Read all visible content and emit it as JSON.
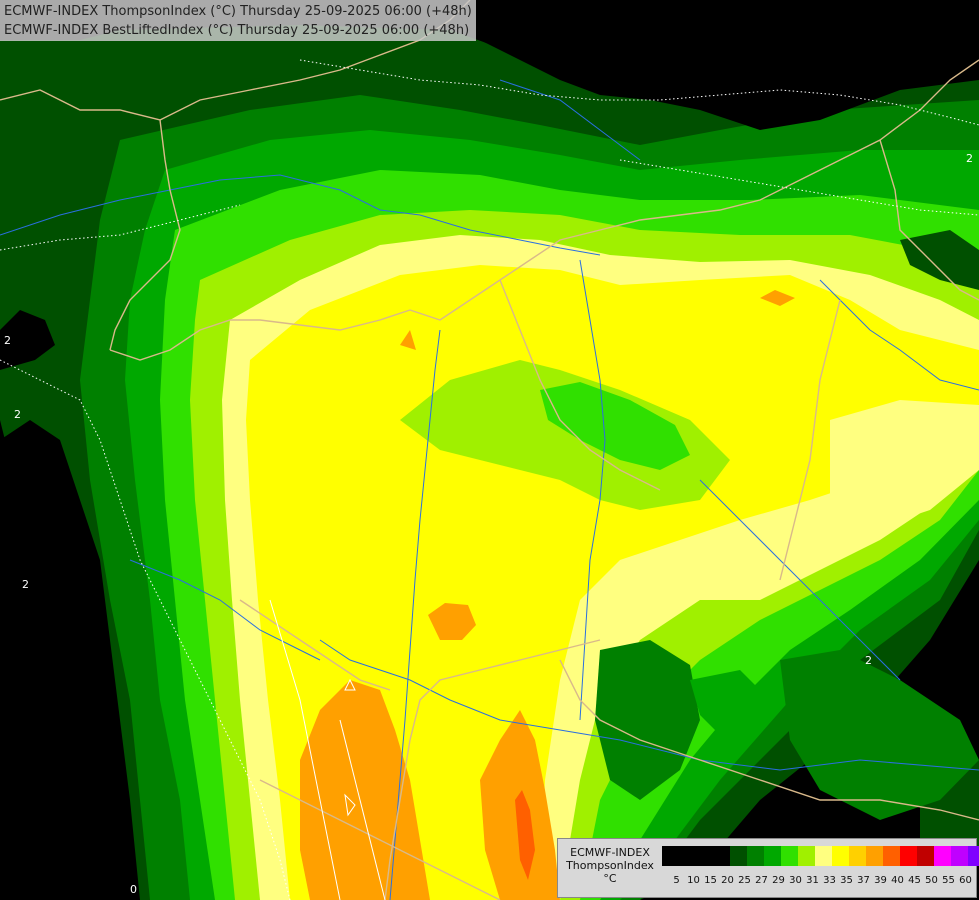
{
  "header": {
    "line1": "ECMWF-INDEX ThompsonIndex (°C) Thursday 25-09-2025 06:00 (+48h)",
    "line2": "ECMWF-INDEX BestLiftedIndex (°C) Thursday 25-09-2025 06:00 (+48h)"
  },
  "legend": {
    "title": "ECMWF-INDEX",
    "name": "ThompsonIndex",
    "unit": "°C",
    "ticks": [
      "5",
      "10",
      "15",
      "20",
      "25",
      "27",
      "29",
      "30",
      "31",
      "33",
      "35",
      "37",
      "39",
      "40",
      "45",
      "50",
      "55",
      "60"
    ],
    "colors": [
      "#000000",
      "#000000",
      "#000000",
      "#000000",
      "#005000",
      "#008000",
      "#00a800",
      "#30e000",
      "#a0f000",
      "#ffff80",
      "#ffff00",
      "#ffd000",
      "#ffa000",
      "#ff6000",
      "#ff0000",
      "#c00000",
      "#ff00ff",
      "#c000ff",
      "#8000ff",
      "#6000ff",
      "#0000ff"
    ]
  },
  "map": {
    "contour_labels": [
      "2",
      "2",
      "2",
      "2",
      "2",
      "0"
    ],
    "field_colors": {
      "black": "#000000",
      "dark_green": "#005000",
      "green": "#008000",
      "mid_green": "#00a800",
      "bright_green": "#30e000",
      "lime": "#a0f000",
      "pale_yellow": "#ffff80",
      "yellow": "#ffff00",
      "orange": "#ffa000",
      "dark_orange": "#ff8000",
      "red_orange": "#ff6000"
    }
  }
}
